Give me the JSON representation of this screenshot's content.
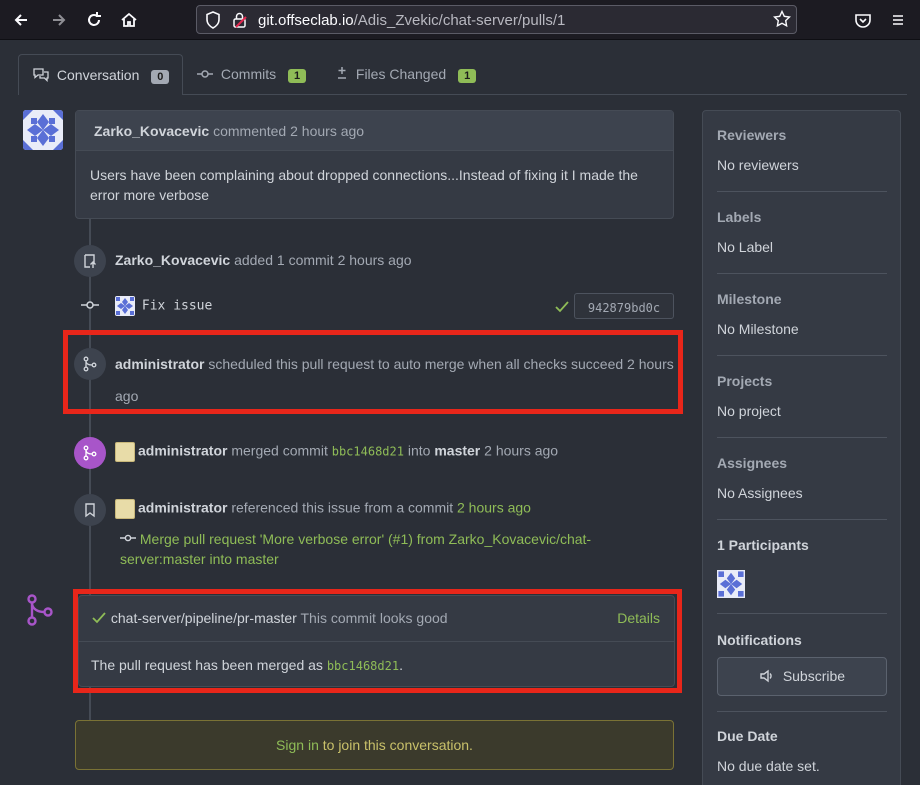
{
  "browser": {
    "url_host": "git.offseclab.io",
    "url_path": "/Adis_Zvekic/chat-server/pulls/1"
  },
  "tabs": [
    {
      "label": "Conversation",
      "count": "0",
      "count_color": "#a3a9b3"
    },
    {
      "label": "Commits",
      "count": "1",
      "count_color": "#8fbc57"
    },
    {
      "label": "Files Changed",
      "count": "1",
      "count_color": "#8fbc57"
    }
  ],
  "comment": {
    "author": "Zarko_Kovacevic",
    "action": "commented",
    "time": "2 hours ago",
    "body": "Users have been complaining about dropped connections...Instead of fixing it I made the error more verbose"
  },
  "events": {
    "added_commit": {
      "author": "Zarko_Kovacevic",
      "text": "added 1 commit",
      "time": "2 hours ago"
    },
    "commit": {
      "message": "Fix issue",
      "sha": "942879bd0c"
    },
    "auto_merge": {
      "author": "administrator",
      "text": "scheduled this pull request to auto merge when all checks succeed 2 hours",
      "text2": "ago"
    },
    "merged": {
      "author": "administrator",
      "text": "merged commit",
      "sha": "bbc1468d21",
      "into": "into",
      "branch": "master",
      "time": "2 hours ago"
    },
    "referenced": {
      "author": "administrator",
      "text": "referenced this issue from a commit",
      "time": "2 hours ago",
      "commit_line1": "Merge pull request 'More verbose error' (#1) from Zarko_Kovacevic/chat-",
      "commit_line2": "server:master into master"
    }
  },
  "pipeline": {
    "name": "chat-server/pipeline/pr-master",
    "status": "This commit looks good",
    "details_label": "Details",
    "merged_text": "The pull request has been merged as",
    "merged_sha": "bbc1468d21",
    "merged_suffix": "."
  },
  "signin": {
    "link": "Sign in",
    "text": "to join this conversation."
  },
  "sidebar": {
    "reviewers": {
      "title": "Reviewers",
      "value": "No reviewers"
    },
    "labels": {
      "title": "Labels",
      "value": "No Label"
    },
    "milestone": {
      "title": "Milestone",
      "value": "No Milestone"
    },
    "projects": {
      "title": "Projects",
      "value": "No project"
    },
    "assignees": {
      "title": "Assignees",
      "value": "No Assignees"
    },
    "participants": {
      "title": "1 Participants"
    },
    "notifications": {
      "title": "Notifications",
      "button": "Subscribe"
    },
    "due_date": {
      "title": "Due Date",
      "value": "No due date set."
    }
  },
  "colors": {
    "accent_green": "#8fbc57",
    "merge_purple": "#a855c9",
    "highlight_red": "#e8261a"
  }
}
